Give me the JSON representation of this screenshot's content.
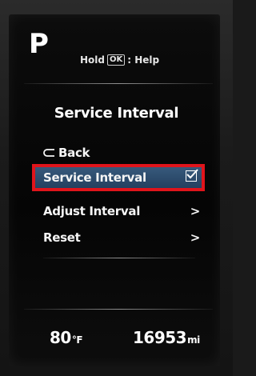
{
  "header": {
    "gear": "P",
    "help_prefix": "Hold",
    "help_key": "OK",
    "help_suffix": ": Help"
  },
  "menu": {
    "title": "Service Interval",
    "items": [
      {
        "label": "Back",
        "icon": "back-arrow-icon",
        "indicator": ""
      },
      {
        "label": "Service Interval",
        "icon": "",
        "indicator": "checked",
        "selected": true
      },
      {
        "label": "Adjust Interval",
        "icon": "",
        "indicator": ">"
      },
      {
        "label": "Reset",
        "icon": "",
        "indicator": ">"
      }
    ]
  },
  "status": {
    "temperature_value": "80",
    "temperature_unit": "°F",
    "odometer_value": "16953",
    "odometer_unit": "mi"
  },
  "colors": {
    "highlight_border": "#e0141b",
    "selection_fill": "#2e4e70",
    "text": "#ffffff",
    "screen": "#070707"
  }
}
